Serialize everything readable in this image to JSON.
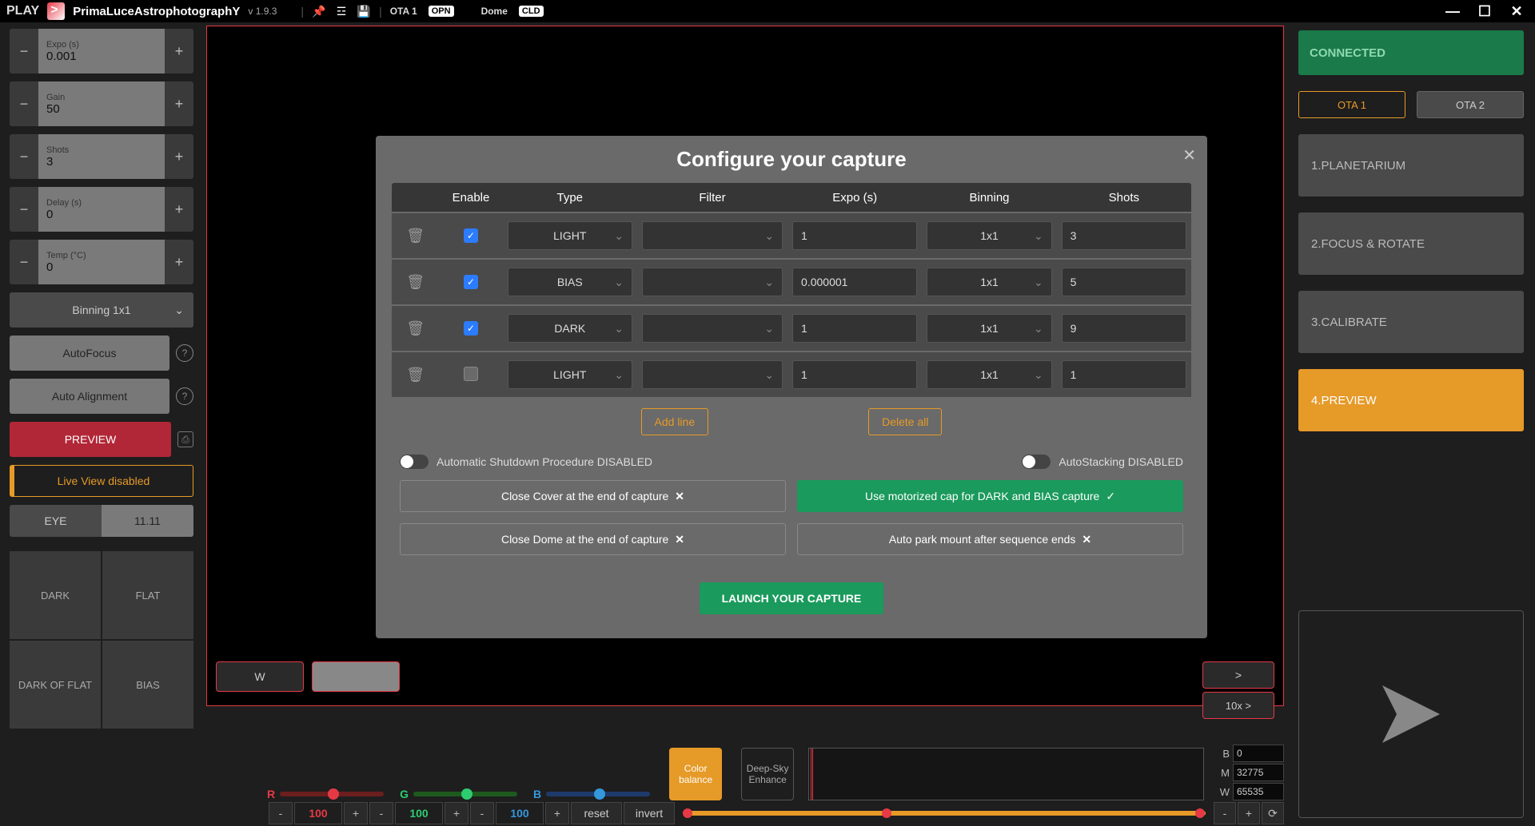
{
  "titlebar": {
    "play": "PLAY",
    "appname": "PrimaLuceAstrophotographY",
    "version": "v 1.9.3",
    "ota1_lbl": "OTA 1",
    "ota1_badge": "OPN",
    "dome_lbl": "Dome",
    "dome_badge": "CLD"
  },
  "left": {
    "expo": {
      "label": "Expo (s)",
      "value": "0.001"
    },
    "gain": {
      "label": "Gain",
      "value": "50"
    },
    "shots": {
      "label": "Shots",
      "value": "3"
    },
    "delay": {
      "label": "Delay (s)",
      "value": "0"
    },
    "temp": {
      "label": "Temp (°C)",
      "value": "0"
    },
    "binning": "Binning 1x1",
    "autofocus": "AutoFocus",
    "autoalign": "Auto Alignment",
    "preview": "PREVIEW",
    "liveview": "Live View disabled",
    "eye_lbl": "EYE",
    "eye_val": "11.11",
    "quad": [
      "DARK",
      "FLAT",
      "DARK OF FLAT",
      "BIAS"
    ]
  },
  "center": {
    "w": "W",
    "gt": ">",
    "tenx": "10x >",
    "rgb_labels": [
      "R",
      "G",
      "B"
    ],
    "rgb_values": [
      "100",
      "100",
      "100"
    ],
    "reset": "reset",
    "invert": "invert",
    "color_balance": "Color balance",
    "deepsky": "Deep-Sky Enhance",
    "bmw": [
      {
        "k": "B",
        "v": "0"
      },
      {
        "k": "M",
        "v": "32775"
      },
      {
        "k": "W",
        "v": "65535"
      }
    ]
  },
  "right": {
    "connected": "CONNECTED",
    "ota1": "OTA 1",
    "ota2": "OTA 2",
    "steps": [
      "1.PLANETARIUM",
      "2.FOCUS & ROTATE",
      "3.CALIBRATE",
      "4.PREVIEW"
    ]
  },
  "modal": {
    "title": "Configure your capture",
    "headers": [
      "Enable",
      "Type",
      "Filter",
      "Expo (s)",
      "Binning",
      "Shots"
    ],
    "rows": [
      {
        "enabled": true,
        "type": "LIGHT",
        "filter": "",
        "expo": "1",
        "binning": "1x1",
        "shots": "3"
      },
      {
        "enabled": true,
        "type": "BIAS",
        "filter": "",
        "expo": "0.000001",
        "binning": "1x1",
        "shots": "5"
      },
      {
        "enabled": true,
        "type": "DARK",
        "filter": "",
        "expo": "1",
        "binning": "1x1",
        "shots": "9"
      },
      {
        "enabled": false,
        "type": "LIGHT",
        "filter": "",
        "expo": "1",
        "binning": "1x1",
        "shots": "1"
      }
    ],
    "add_line": "Add line",
    "delete_all": "Delete all",
    "auto_shutdown": "Automatic Shutdown Procedure DISABLED",
    "autostack": "AutoStacking DISABLED",
    "close_cover": "Close Cover at the end of capture",
    "motorized_cap": "Use motorized cap for DARK and BIAS capture",
    "close_dome": "Close Dome at the end of capture",
    "auto_park": "Auto park mount after sequence ends",
    "launch": "LAUNCH YOUR CAPTURE"
  }
}
